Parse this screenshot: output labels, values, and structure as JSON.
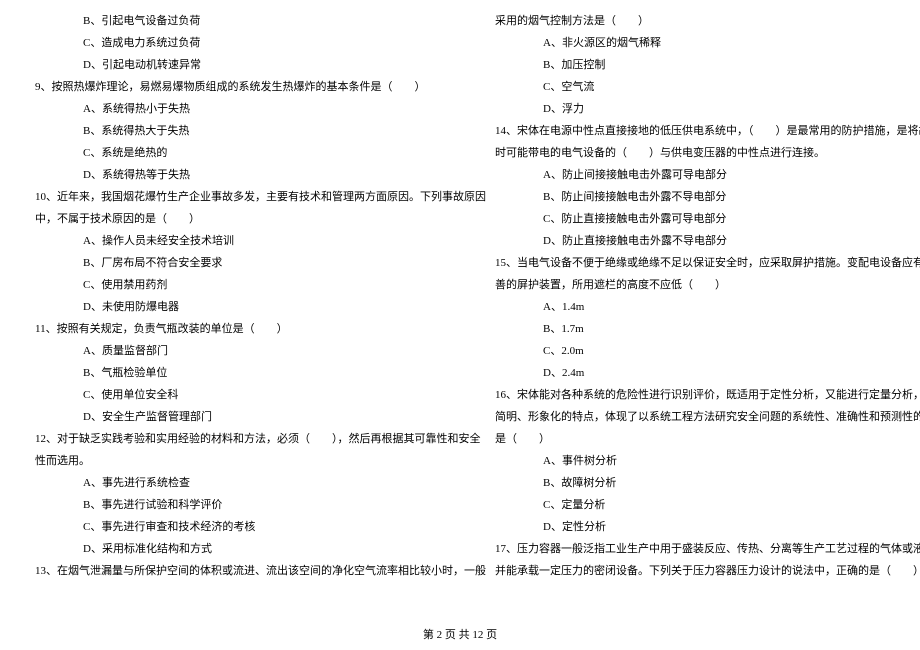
{
  "left_column": {
    "q8_options": {
      "b": "B、引起电气设备过负荷",
      "c": "C、造成电力系统过负荷",
      "d": "D、引起电动机转速异常"
    },
    "q9": {
      "stem": "9、按照热爆炸理论，易燃易爆物质组成的系统发生热爆炸的基本条件是（　　）",
      "a": "A、系统得热小于失热",
      "b": "B、系统得热大于失热",
      "c": "C、系统是绝热的",
      "d": "D、系统得热等于失热"
    },
    "q10": {
      "stem1": "10、近年来，我国烟花爆竹生产企业事故多发，主要有技术和管理两方面原因。下列事故原因",
      "stem2": "中，不属于技术原因的是（　　）",
      "a": "A、操作人员未经安全技术培训",
      "b": "B、厂房布局不符合安全要求",
      "c": "C、使用禁用药剂",
      "d": "D、未使用防爆电器"
    },
    "q11": {
      "stem": "11、按照有关规定，负责气瓶改装的单位是（　　）",
      "a": "A、质量监督部门",
      "b": "B、气瓶检验单位",
      "c": "C、使用单位安全科",
      "d": "D、安全生产监督管理部门"
    },
    "q12": {
      "stem1": "12、对于缺乏实践考验和实用经验的材料和方法，必须（　　），然后再根据其可靠性和安全",
      "stem2": "性而选用。",
      "a": "A、事先进行系统检查",
      "b": "B、事先进行试验和科学评价",
      "c": "C、事先进行审查和技术经济的考核",
      "d": "D、采用标准化结构和方式"
    },
    "q13": {
      "stem": "13、在烟气泄漏量与所保护空间的体积或流进、流出该空间的净化空气流率相比较小时，一般"
    }
  },
  "right_column": {
    "q13_cont": {
      "stem": "采用的烟气控制方法是（　　）",
      "a": "A、非火源区的烟气稀释",
      "b": "B、加压控制",
      "c": "C、空气流",
      "d": "D、浮力"
    },
    "q14": {
      "stem1": "14、宋体在电源中性点直接接地的低压供电系统中，（　　）是最常用的防护措施，是将故障",
      "stem2": "时可能带电的电气设备的（　　）与供电变压器的中性点进行连接。",
      "a": "A、防止间接接触电击外露可导电部分",
      "b": "B、防止间接接触电击外露不导电部分",
      "c": "C、防止直接接触电击外露可导电部分",
      "d": "D、防止直接接触电击外露不导电部分"
    },
    "q15": {
      "stem1": "15、当电气设备不便于绝缘或绝缘不足以保证安全时，应采取屏护措施。变配电设备应有完",
      "stem2": "善的屏护装置，所用遮栏的高度不应低（　　）",
      "a": "A、1.4m",
      "b": "B、1.7m",
      "c": "C、2.0m",
      "d": "D、2.4m"
    },
    "q16": {
      "stem1": "16、宋体能对各种系统的危险性进行识别评价，既适用于定性分析，又能进行定量分析，具有",
      "stem2": "简明、形象化的特点，体现了以系统工程方法研究安全问题的系统性、准确性和预测性的分析",
      "stem3": "是（　　）",
      "a": "A、事件树分析",
      "b": "B、故障树分析",
      "c": "C、定量分析",
      "d": "D、定性分析"
    },
    "q17": {
      "stem1": "17、压力容器一般泛指工业生产中用于盛装反应、传热、分离等生产工艺过程的气体或液体，",
      "stem2": "并能承载一定压力的密闭设备。下列关于压力容器压力设计的说法中，正确的是（　　）"
    }
  },
  "footer": "第 2 页 共 12 页"
}
